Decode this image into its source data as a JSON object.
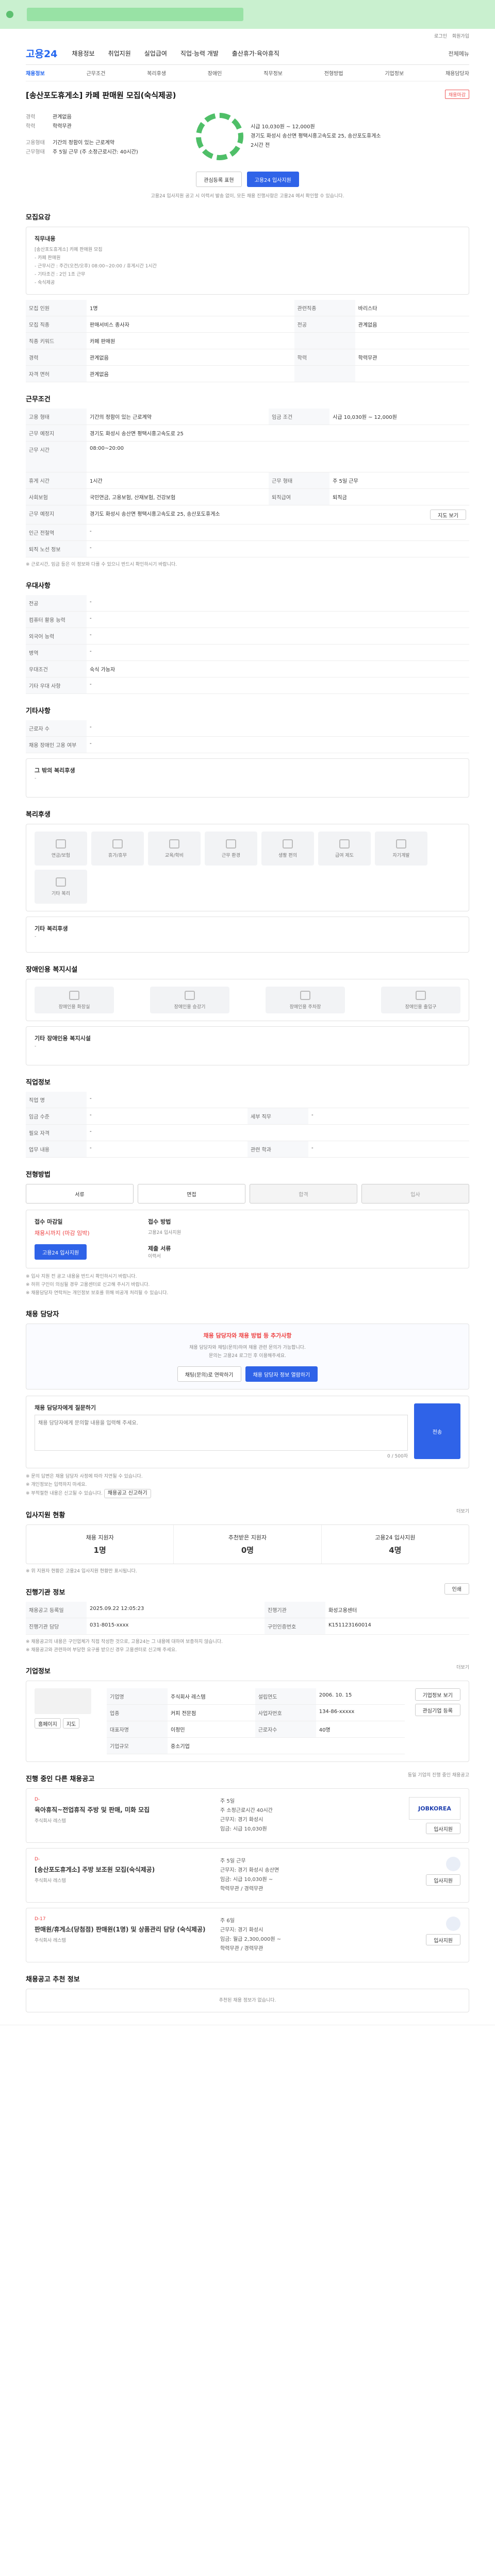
{
  "brand": {
    "logo": "고용24"
  },
  "util_links": [
    "로그인",
    "회원가입"
  ],
  "gnb": {
    "items": [
      "채용정보",
      "취업지원",
      "실업급여",
      "직업·능력 개발",
      "출산휴가·육아휴직"
    ],
    "right": "전체메뉴"
  },
  "subnav": {
    "items": [
      "채용정보",
      "근무조건",
      "복리후생",
      "장애인",
      "직무정보",
      "전형방법",
      "기업정보",
      "채용담당자"
    ],
    "active": 0
  },
  "job": {
    "title": "[송산포도휴게소] 카페 판매원 모집(숙식제공)",
    "badge": "채용마감",
    "company_label": "기업명",
    "fields": [
      {
        "k": "경력",
        "v": "관계없음"
      },
      {
        "k": "학력",
        "v": "학력무관"
      },
      {
        "k": "고용형태",
        "v": "기간의 정함이 있는 근로계약"
      },
      {
        "k": "근무형태",
        "v": "주 5일 근무 (주 소정근로시간: 40시간)"
      },
      {
        "k": "근무지역",
        "v": "경기도 화성시 송산면 평택시흥고속도로 25, 송산포도휴게소"
      }
    ],
    "wage_label": "시급 10,030원 ~ 12,000원",
    "ring_label": "2시간 전",
    "buttons": {
      "interest": "관심등록 표현",
      "apply": "고용24 입사지원"
    },
    "notice": "고용24 입사지원 공고 시 이력서 발송 없이, 모든 채용 진행사항은 고용24 에서 확인할 수 있습니다."
  },
  "recruit": {
    "title": "모집요강",
    "duty_label": "직무내용",
    "duty_lines": [
      "[송산포도휴게소] 카페 판매원 모집",
      "- 카페 판매원",
      "- 근무시간 : 주간(오전/오후) 08:00~20:00 / 휴게시간 1시간",
      "- 기타조건 : 2인 1조 근무",
      "- 숙식제공"
    ],
    "rows": [
      {
        "k1": "모집 인원",
        "v1": "1명",
        "k2": "관련직종",
        "v2": "바리스타"
      },
      {
        "k1": "모집 직종",
        "v1": "판매서비스 종사자",
        "k2": "전공",
        "v2": "관계없음"
      },
      {
        "k1": "직종 키워드",
        "v1": "카페 판매원",
        "k2": "",
        "v2": ""
      },
      {
        "k1": "경력",
        "v1": "관계없음",
        "k2": "학력",
        "v2": "학력무관"
      },
      {
        "k1": "자격 면허",
        "v1": "관계없음",
        "k2": "",
        "v2": ""
      }
    ]
  },
  "conditions": {
    "title": "근무조건",
    "rows": [
      {
        "k1": "고용 형태",
        "v1": "기간의 정함이 있는 근로계약",
        "k2": "임금 조건",
        "v2": "시급 10,030원 ~ 12,000원"
      },
      {
        "k1": "근무 예정지",
        "v1": "경기도 화성시 송산면 평택시흥고속도로 25",
        "k2": "",
        "v2": ""
      },
      {
        "k1": "근무 시간",
        "v1": "08:00~20:00",
        "k2": "",
        "v2": ""
      },
      {
        "k1": "휴게 시간",
        "v1": "1시간",
        "k2": "근무 형태",
        "v2": "주 5일 근무"
      },
      {
        "k1": "사회보험",
        "v1": "국민연금, 고용보험, 산재보험, 건강보험",
        "k2": "퇴직급여",
        "v2": "퇴직금"
      },
      {
        "k1": "근무 예정지",
        "v1": "경기도 화성시 송산면 평택시흥고속도로 25, 송산포도휴게소",
        "k2": "",
        "v2": ""
      },
      {
        "k1": "인근 전철역",
        "v1": "-",
        "k2": "",
        "v2": ""
      },
      {
        "k1": "퇴직 노선 정보",
        "v1": "-",
        "k2": "",
        "v2": ""
      }
    ],
    "map_btn": "지도 보기",
    "footnote": "※ 근로시간, 임금 등은 이 정보와 다를 수 있으니 반드시 확인하시기 바랍니다."
  },
  "prefer": {
    "title": "우대사항",
    "rows": [
      {
        "k": "전공",
        "v": "-"
      },
      {
        "k": "컴퓨터 활용 능력",
        "v": "-"
      },
      {
        "k": "외국어 능력",
        "v": "-"
      },
      {
        "k": "병역",
        "v": "-"
      },
      {
        "k": "우대조건",
        "v": "숙식 가능자"
      },
      {
        "k": "기타 우대 사항",
        "v": "-"
      }
    ]
  },
  "other": {
    "title": "기타사항",
    "rows": [
      {
        "k": "근로자 수",
        "v": "-"
      },
      {
        "k": "채용 장애인 고용 여부",
        "v": "-"
      }
    ],
    "extra_label": "그 밖의 복리후생",
    "extra_value": "-"
  },
  "welfare": {
    "title": "복리후생",
    "tiles": [
      "연금/보험",
      "휴가/휴무",
      "교육/학비",
      "근무 환경",
      "생활 편의",
      "급여 제도",
      "자기계발",
      "기타 복리"
    ],
    "extra_label": "기타 복리후생",
    "extra_value": "-"
  },
  "disabled": {
    "title": "장애인용 복지시설",
    "tiles": [
      "장애인용 화장실",
      "장애인용 승강기",
      "장애인용 주차장",
      "장애인용 출입구"
    ],
    "extra_label": "기타 장애인용 복지시설",
    "extra_value": "-"
  },
  "jobinfo": {
    "title": "직업정보",
    "rows": [
      {
        "k1": "직업 명",
        "v1": "-",
        "k2": "",
        "v2": ""
      },
      {
        "k1": "임금 수준",
        "v1": "-",
        "k2": "세부 직무",
        "v2": "-"
      },
      {
        "k1": "필요 자격",
        "v1": "-",
        "k2": "",
        "v2": ""
      },
      {
        "k1": "업무 내용",
        "v1": "-",
        "k2": "관련 학과",
        "v2": "-"
      }
    ]
  },
  "process": {
    "title": "전형방법",
    "steps": [
      "서류",
      "면접",
      "합격",
      "입사"
    ],
    "apply_head": "접수 마감일",
    "apply_val": "채용시까지 (마감 임박)",
    "method_head": "접수 방법",
    "method_val": "고용24 입사지원",
    "docs_head": "제출 서류",
    "docs_val": "이력서",
    "apply_btn": "고용24 입사지원",
    "notes": [
      "※ 입사 지원 전 공고 내용을 반드시 확인하시기 바랍니다.",
      "※ 허위 구인이 의심될 경우 고용센터로 신고해 주시기 바랍니다.",
      "※ 채용담당자 연락처는 개인정보 보호를 위해 비공개 처리될 수 있습니다."
    ]
  },
  "manager": {
    "title": "채용 담당자",
    "alert_title": "채용 담당자와 채용 방법 등 추가사항",
    "alert_desc": "채용 담당자와 채팅(문의)하여 채용 관련 문의가 가능합니다.",
    "alert_desc2": "문의는 고용24 로그인 후 이용해주세요.",
    "btn1": "채팅(문의)로 연락하기",
    "btn2": "채용 담당자 정보 열람하기",
    "box_title": "채용 담당자에게 질문하기",
    "box_placeholder": "채용 담당자에게 문의할 내용을 입력해 주세요.",
    "box_count": "0 / 500자",
    "box_btn": "전송",
    "notes": [
      "※ 문의 답변은 채용 담당자 사정에 따라 지연될 수 있습니다.",
      "※ 개인정보는 입력하지 마세요.",
      "※ 부적절한 내용은 신고될 수 있습니다."
    ],
    "report_btn": "채용공고 신고하기"
  },
  "status": {
    "title": "입사지원 현황",
    "more": "더보기",
    "items": [
      {
        "label": "채용 지원자",
        "value": "1명"
      },
      {
        "label": "추천받은 지원자",
        "value": "0명"
      },
      {
        "label": "고용24 입사지원",
        "value": "4명"
      }
    ],
    "note": "※ 위 지원자 현황은 고용24 입사지원 현황만 표시됩니다."
  },
  "reg": {
    "title": "진행기관 정보",
    "print": "인쇄",
    "rows": [
      {
        "k1": "채용공고 등록일",
        "v1": "2025.09.22 12:05:23",
        "k2": "진행기관",
        "v2": "화성고용센터"
      },
      {
        "k1": "진행기관 담당",
        "v1": "031-8015-xxxx",
        "k2": "구인인증번호",
        "v2": "K151123160014"
      }
    ],
    "notes": [
      "※ 채용공고의 내용은 구인업체가 직접 작성한 것으로, 고용24는 그 내용에 대하여 보증하지 않습니다.",
      "※ 채용공고와 관련하여 부당한 요구를 받으신 경우 고용센터로 신고해 주세요."
    ]
  },
  "company": {
    "title": "기업정보",
    "more": "더보기",
    "rows": [
      {
        "k1": "기업명",
        "v1": "주식회사 레스템",
        "k2": "설립연도",
        "v2": "2006. 10. 15"
      },
      {
        "k1": "업종",
        "v1": "커피 전문점",
        "k2": "사업자번호",
        "v2": "134-86-xxxxx"
      },
      {
        "k1": "대표자명",
        "v1": "이정민",
        "k2": "근로자수",
        "v2": "40명"
      },
      {
        "k1": "기업규모",
        "v1": "중소기업",
        "k2": "",
        "v2": ""
      }
    ],
    "btn1": "기업정보 보기",
    "btn2": "관심기업 등록",
    "small_btns": [
      "홈페이지",
      "지도"
    ]
  },
  "others": {
    "title": "진행 중인 다른 채용공고",
    "note": "동일 기업의 진행 중인 채용공고",
    "cards": [
      {
        "tag": "D-",
        "title": "육아휴직~전업휴직 주방 및 판매, 미화 모집",
        "company": "주식회사 레스템",
        "info": [
          "주 5일",
          "주 소정근로시간 40시간",
          "근무지: 경기 화성시",
          "임금: 시급 10,030원",
          "학력무관 / 경력무관"
        ],
        "logo": "JOBKOREA",
        "btn": "입사지원"
      },
      {
        "tag": "D-",
        "title": "[송산포도휴게소] 주방 보조원 모집(숙식제공)",
        "company": "주식회사 레스템",
        "info": [
          "주 5일 근무",
          "근무지: 경기 화성시 송산면",
          "임금: 시급 10,030원 ~",
          "학력무관 / 경력무관"
        ],
        "logo": "",
        "btn": "입사지원"
      },
      {
        "tag": "D-17",
        "title": "판매원/휴게소(당첨점) 판매원(1명) 및 상품관리 담당 (숙식제공)",
        "company": "주식회사 레스템",
        "info": [
          "주 6일",
          "근무지: 경기 화성시",
          "임금: 월급 2,300,000원 ~",
          "학력무관 / 경력무관"
        ],
        "logo": "",
        "btn": "입사지원"
      }
    ]
  },
  "recent": {
    "title": "채용공고 추천 정보",
    "empty": "추천된 채용 정보가 없습니다."
  },
  "colors": {
    "primary": "#2f63e8",
    "accent_green": "#4fbf68",
    "danger": "#e44444",
    "banner": "#c9f0cf"
  }
}
